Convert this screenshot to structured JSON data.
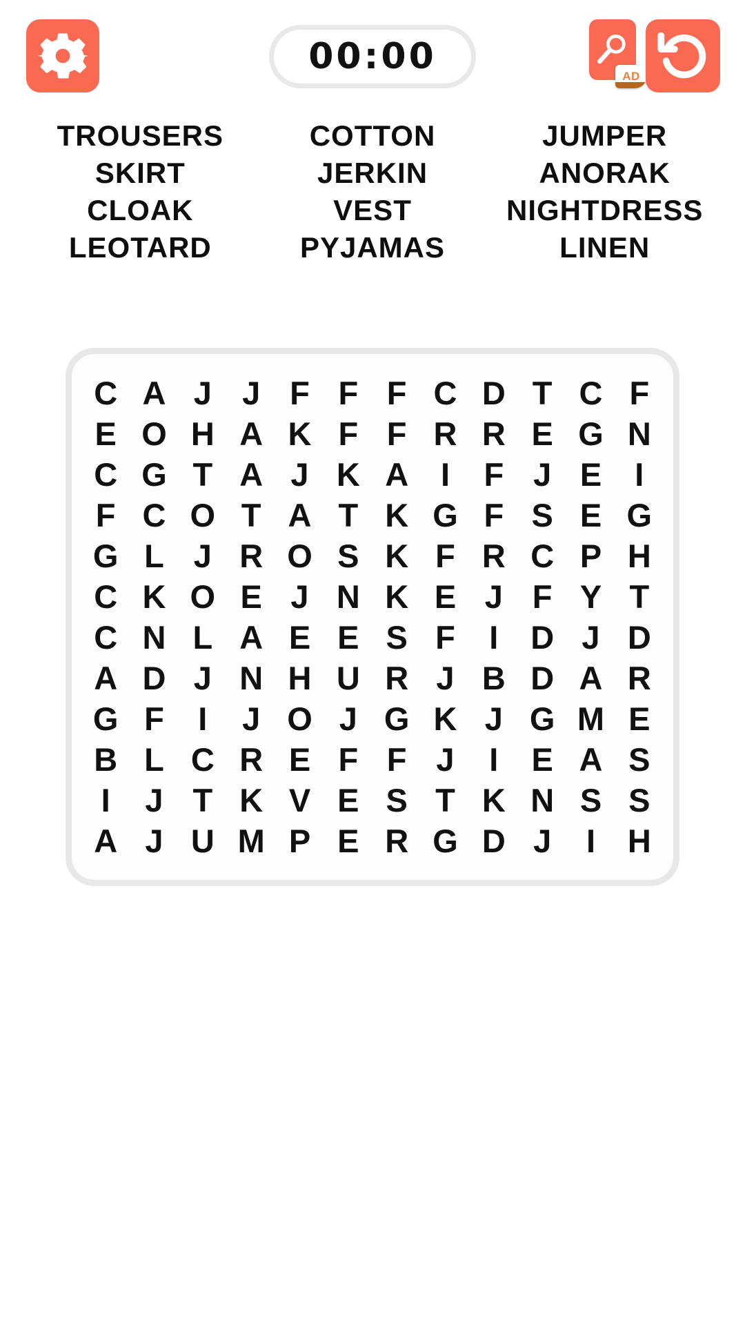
{
  "theme": {
    "accent": "#fa6a53",
    "card_border": "#e8e8e8",
    "text": "#111111",
    "background": "#ffffff",
    "ad_badge_text": "#e8823a"
  },
  "topbar": {
    "settings_icon": "gear-icon",
    "timer": "00:00",
    "hint_icon": "magnifier-icon",
    "hint_ad_label": "AD",
    "restart_icon": "undo-arrow-icon"
  },
  "wordlist": {
    "columns": [
      {
        "words": [
          "TROUSERS",
          "SKIRT",
          "CLOAK",
          "LEOTARD"
        ]
      },
      {
        "words": [
          "COTTON",
          "JERKIN",
          "VEST",
          "PYJAMAS"
        ]
      },
      {
        "words": [
          "JUMPER",
          "ANORAK",
          "NIGHTDRESS",
          "LINEN"
        ]
      }
    ]
  },
  "grid": {
    "rows": 12,
    "cols": 12,
    "letters": [
      [
        "C",
        "A",
        "J",
        "J",
        "F",
        "F",
        "F",
        "C",
        "D",
        "T",
        "C",
        "F"
      ],
      [
        "E",
        "O",
        "H",
        "A",
        "K",
        "F",
        "F",
        "R",
        "R",
        "E",
        "G",
        "N"
      ],
      [
        "C",
        "G",
        "T",
        "A",
        "J",
        "K",
        "A",
        "I",
        "F",
        "J",
        "E",
        "I"
      ],
      [
        "F",
        "C",
        "O",
        "T",
        "A",
        "T",
        "K",
        "G",
        "F",
        "S",
        "E",
        "G"
      ],
      [
        "G",
        "L",
        "J",
        "R",
        "O",
        "S",
        "K",
        "F",
        "R",
        "C",
        "P",
        "H"
      ],
      [
        "C",
        "K",
        "O",
        "E",
        "J",
        "N",
        "K",
        "E",
        "J",
        "F",
        "Y",
        "T"
      ],
      [
        "C",
        "N",
        "L",
        "A",
        "E",
        "E",
        "S",
        "F",
        "I",
        "D",
        "J",
        "D"
      ],
      [
        "A",
        "D",
        "J",
        "N",
        "H",
        "U",
        "R",
        "J",
        "B",
        "D",
        "A",
        "R"
      ],
      [
        "G",
        "F",
        "I",
        "J",
        "O",
        "J",
        "G",
        "K",
        "J",
        "G",
        "M",
        "E"
      ],
      [
        "B",
        "L",
        "C",
        "R",
        "E",
        "F",
        "F",
        "J",
        "I",
        "E",
        "A",
        "S"
      ],
      [
        "I",
        "J",
        "T",
        "K",
        "V",
        "E",
        "S",
        "T",
        "K",
        "N",
        "S",
        "S"
      ],
      [
        "A",
        "J",
        "U",
        "M",
        "P",
        "E",
        "R",
        "G",
        "D",
        "J",
        "I",
        "H"
      ]
    ]
  }
}
